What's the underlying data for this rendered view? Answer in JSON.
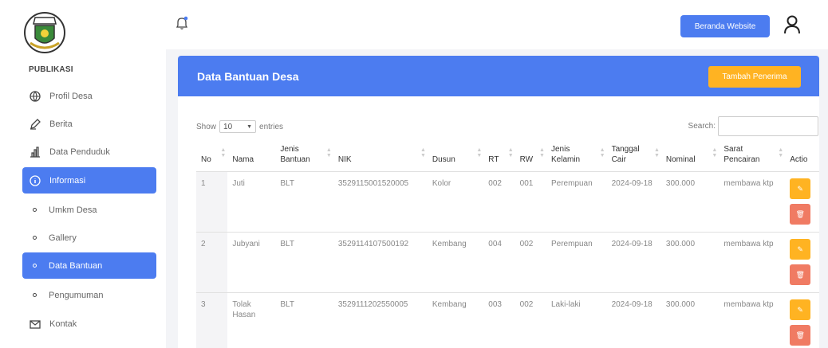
{
  "sidebar": {
    "section_title": "PUBLIKASI",
    "items": [
      {
        "label": "Profil Desa",
        "icon": "globe-icon"
      },
      {
        "label": "Berita",
        "icon": "edit-icon"
      },
      {
        "label": "Data Penduduk",
        "icon": "chart-icon"
      },
      {
        "label": "Informasi",
        "icon": "info-icon"
      },
      {
        "label": "Umkm Desa",
        "icon": "bullet-icon"
      },
      {
        "label": "Gallery",
        "icon": "bullet-icon"
      },
      {
        "label": "Data Bantuan",
        "icon": "bullet-icon"
      },
      {
        "label": "Pengumuman",
        "icon": "bullet-icon"
      },
      {
        "label": "Kontak",
        "icon": "mail-icon"
      }
    ]
  },
  "header": {
    "beranda_label": "Beranda Website"
  },
  "card": {
    "title": "Data Bantuan Desa",
    "add_label": "Tambah Penerima"
  },
  "controls": {
    "show_label": "Show",
    "entries_value": "10",
    "entries_label": "entries",
    "search_label": "Search:",
    "search_value": ""
  },
  "table": {
    "headers": [
      "No",
      "Nama",
      "Jenis Bantuan",
      "NIK",
      "Dusun",
      "RT",
      "RW",
      "Jenis Kelamin",
      "Tanggal Cair",
      "Nominal",
      "Sarat Pencairan",
      "Actio"
    ],
    "rows": [
      [
        "1",
        "Juti",
        "BLT",
        "3529115001520005",
        "Kolor",
        "002",
        "001",
        "Perempuan",
        "2024-09-18",
        "300.000",
        "membawa ktp"
      ],
      [
        "2",
        "Jubyani",
        "BLT",
        "3529114107500192",
        "Kembang",
        "004",
        "002",
        "Perempuan",
        "2024-09-18",
        "300.000",
        "membawa ktp"
      ],
      [
        "3",
        "Tolak Hasan",
        "BLT",
        "3529111202550005",
        "Kembang",
        "003",
        "002",
        "Laki-laki",
        "2024-09-18",
        "300.000",
        "membawa ktp"
      ]
    ]
  },
  "colors": {
    "primary": "#4c7cf0",
    "warning": "#ffb322",
    "danger": "#f07b63"
  }
}
